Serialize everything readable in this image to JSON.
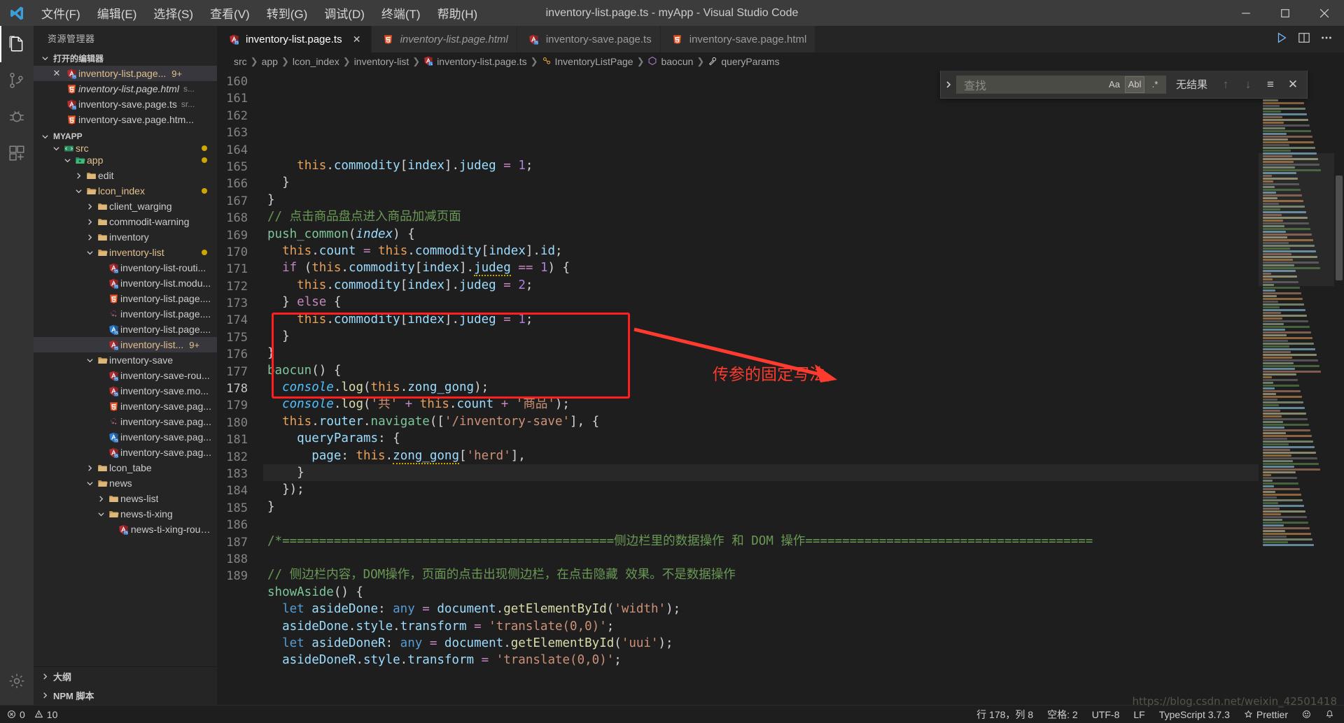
{
  "titlebar": {
    "window_title": "inventory-list.page.ts - myApp - Visual Studio Code",
    "menus": [
      "文件(F)",
      "编辑(E)",
      "选择(S)",
      "查看(V)",
      "转到(G)",
      "调试(D)",
      "终端(T)",
      "帮助(H)"
    ],
    "controls": {
      "minimize": "minimize",
      "maximize": "maximize",
      "close": "close"
    }
  },
  "activitybar": {
    "items": [
      {
        "name": "explorer",
        "icon": "files-icon"
      },
      {
        "name": "source-control",
        "icon": "source-control-icon"
      },
      {
        "name": "debug",
        "icon": "debug-icon"
      },
      {
        "name": "extensions",
        "icon": "extensions-icon"
      },
      {
        "name": "settings",
        "icon": "gear-icon"
      }
    ]
  },
  "sidebar": {
    "title": "资源管理器",
    "open_editors": {
      "label": "打开的编辑器",
      "items": [
        {
          "name": "inventory-list.page...",
          "badge": "9+",
          "icon": "angular-ts-icon",
          "selected": true,
          "italic": false,
          "modified": true
        },
        {
          "name": "inventory-list.page.html",
          "path": "s...",
          "icon": "html-icon",
          "italic": true,
          "modified": false
        },
        {
          "name": "inventory-save.page.ts",
          "path": "sr...",
          "icon": "angular-ts-icon",
          "italic": false,
          "modified": false
        },
        {
          "name": "inventory-save.page.htm...",
          "path": "",
          "icon": "html-icon",
          "italic": false,
          "modified": false
        }
      ]
    },
    "workspace": {
      "label": "MYAPP",
      "tree": [
        {
          "label": "src",
          "type": "folder-open",
          "depth": 1,
          "icon": "src-folder-icon",
          "modified": true,
          "clipped": true
        },
        {
          "label": "app",
          "type": "folder-open",
          "depth": 2,
          "icon": "app-folder-icon",
          "modified": true
        },
        {
          "label": "edit",
          "type": "folder",
          "depth": 3,
          "icon": "folder-icon"
        },
        {
          "label": "lcon_index",
          "type": "folder-open",
          "depth": 3,
          "icon": "folder-open-icon",
          "modified": true
        },
        {
          "label": "client_warging",
          "type": "folder",
          "depth": 4,
          "icon": "folder-icon"
        },
        {
          "label": "commodit-warning",
          "type": "folder",
          "depth": 4,
          "icon": "folder-icon"
        },
        {
          "label": "inventory",
          "type": "folder",
          "depth": 4,
          "icon": "folder-icon"
        },
        {
          "label": "inventory-list",
          "type": "folder-open",
          "depth": 4,
          "icon": "folder-open-icon",
          "modified": true
        },
        {
          "label": "inventory-list-routi...",
          "type": "file",
          "depth": 5,
          "icon": "angular-ts-icon"
        },
        {
          "label": "inventory-list.modu...",
          "type": "file",
          "depth": 5,
          "icon": "angular-ts-icon"
        },
        {
          "label": "inventory-list.page....",
          "type": "file",
          "depth": 5,
          "icon": "html-icon"
        },
        {
          "label": "inventory-list.page....",
          "type": "file",
          "depth": 5,
          "icon": "sass-icon"
        },
        {
          "label": "inventory-list.page....",
          "type": "file",
          "depth": 5,
          "icon": "spec-ts-icon"
        },
        {
          "label": "inventory-list...",
          "type": "file",
          "depth": 5,
          "icon": "angular-ts-icon",
          "badge": "9+",
          "selected": true,
          "modified": true
        },
        {
          "label": "inventory-save",
          "type": "folder-open",
          "depth": 4,
          "icon": "folder-open-icon"
        },
        {
          "label": "inventory-save-rou...",
          "type": "file",
          "depth": 5,
          "icon": "angular-ts-icon"
        },
        {
          "label": "inventory-save.mo...",
          "type": "file",
          "depth": 5,
          "icon": "angular-ts-icon"
        },
        {
          "label": "inventory-save.pag...",
          "type": "file",
          "depth": 5,
          "icon": "html-icon"
        },
        {
          "label": "inventory-save.pag...",
          "type": "file",
          "depth": 5,
          "icon": "sass-icon"
        },
        {
          "label": "inventory-save.pag...",
          "type": "file",
          "depth": 5,
          "icon": "spec-ts-icon"
        },
        {
          "label": "inventory-save.pag...",
          "type": "file",
          "depth": 5,
          "icon": "angular-ts-icon"
        },
        {
          "label": "lcon_tabe",
          "type": "folder",
          "depth": 4,
          "icon": "folder-icon"
        },
        {
          "label": "news",
          "type": "folder-open",
          "depth": 4,
          "icon": "folder-open-icon"
        },
        {
          "label": "news-list",
          "type": "folder",
          "depth": 5,
          "icon": "folder-icon"
        },
        {
          "label": "news-ti-xing",
          "type": "folder-open",
          "depth": 5,
          "icon": "folder-open-icon"
        },
        {
          "label": "news-ti-xing-routin...",
          "type": "file",
          "depth": 6,
          "icon": "angular-ts-icon"
        }
      ]
    },
    "bottom_sections": [
      "大纲",
      "NPM 脚本"
    ]
  },
  "tabs": [
    {
      "label": "inventory-list.page.ts",
      "icon": "angular-ts-icon",
      "active": true,
      "italic": false,
      "closeable": true
    },
    {
      "label": "inventory-list.page.html",
      "icon": "html-icon",
      "active": false,
      "italic": true,
      "closeable": false
    },
    {
      "label": "inventory-save.page.ts",
      "icon": "angular-ts-icon",
      "active": false,
      "italic": false,
      "closeable": false
    },
    {
      "label": "inventory-save.page.html",
      "icon": "html-icon",
      "active": false,
      "italic": false,
      "closeable": false
    }
  ],
  "tab_actions": [
    "run-icon",
    "split-editor-icon",
    "more-actions-icon"
  ],
  "breadcrumb": [
    {
      "label": "src",
      "icon": ""
    },
    {
      "label": "app",
      "icon": ""
    },
    {
      "label": "lcon_index",
      "icon": ""
    },
    {
      "label": "inventory-list",
      "icon": ""
    },
    {
      "label": "inventory-list.page.ts",
      "icon": "angular-ts-icon"
    },
    {
      "label": "InventoryListPage",
      "icon": "class-icon"
    },
    {
      "label": "baocun",
      "icon": "method-icon"
    },
    {
      "label": "queryParams",
      "icon": "property-icon"
    }
  ],
  "find_widget": {
    "placeholder": "查找",
    "value": "",
    "status": "无结果",
    "options": [
      {
        "name": "match-case",
        "glyph": "Aa",
        "on": false
      },
      {
        "name": "whole-word",
        "glyph": "Abl",
        "on": true
      },
      {
        "name": "regex",
        "glyph": ".*",
        "on": false
      }
    ],
    "buttons": [
      "previous-match",
      "next-match",
      "find-in-selection",
      "close"
    ]
  },
  "editor": {
    "first_line": 160,
    "current_line": 178,
    "lines": [
      {
        "n": 160,
        "html": "<span class=\"ind\">    </span><span class=\"th\">this</span>.<span class=\"pr\">commodity</span>[<span class=\"pr\">index</span>].<span class=\"pr\">judeg</span> <span class=\"pk\">=</span> <span class=\"num\">1</span>;"
      },
      {
        "n": 161,
        "html": "<span class=\"ind\">  </span>}"
      },
      {
        "n": 162,
        "html": "}"
      },
      {
        "n": 163,
        "html": "<span class=\"cm\">// 点击商品盘点进入商品加减页面</span>"
      },
      {
        "n": 164,
        "html": "<span class=\"fd\">push_common</span>(<span class=\"par\">index</span>) {"
      },
      {
        "n": 165,
        "html": "<span class=\"ind\">  </span><span class=\"th\">this</span>.<span class=\"pr\">count</span> <span class=\"pk\">=</span> <span class=\"th\">this</span>.<span class=\"pr\">commodity</span>[<span class=\"pr\">index</span>].<span class=\"pr\">id</span>;"
      },
      {
        "n": 166,
        "html": "<span class=\"ind\">  </span><span class=\"k\">if</span> (<span class=\"th\">this</span>.<span class=\"pr\">commodity</span>[<span class=\"pr\">index</span>].<span class=\"pr wavy\">judeg</span> <span class=\"pk\">==</span> <span class=\"num\">1</span>) {"
      },
      {
        "n": 167,
        "html": "<span class=\"ind\">    </span><span class=\"th\">this</span>.<span class=\"pr\">commodity</span>[<span class=\"pr\">index</span>].<span class=\"pr\">judeg</span> <span class=\"pk\">=</span> <span class=\"num\">2</span>;"
      },
      {
        "n": 168,
        "html": "<span class=\"ind\">  </span>} <span class=\"k\">else</span> {"
      },
      {
        "n": 169,
        "html": "<span class=\"ind\">    </span><span class=\"th\">this</span>.<span class=\"pr\">commodity</span>[<span class=\"pr\">index</span>].<span class=\"pr\">judeg</span> <span class=\"pk\">=</span> <span class=\"num\">1</span>;"
      },
      {
        "n": 170,
        "html": "<span class=\"ind\">  </span>}"
      },
      {
        "n": 171,
        "html": "}"
      },
      {
        "n": 172,
        "html": "<span class=\"fd\">baocun</span>() {"
      },
      {
        "n": 173,
        "html": "<span class=\"ind\">  </span><span class=\"con\">console</span>.<span class=\"fn\">log</span>(<span class=\"th\">this</span>.<span class=\"pr\">zong_gong</span>);"
      },
      {
        "n": 174,
        "html": "<span class=\"ind\">  </span><span class=\"con\">console</span>.<span class=\"fn\">log</span>(<span class=\"st\">'共'</span> <span class=\"pk\">+</span> <span class=\"th\">this</span>.<span class=\"pr\">count</span> <span class=\"pk\">+</span> <span class=\"st\">'商品'</span>);"
      },
      {
        "n": 175,
        "html": "<span class=\"ind\">  </span><span class=\"th\">this</span>.<span class=\"pr\">router</span>.<span class=\"fd\">navigate</span>([<span class=\"st\">'/inventory-save'</span>], {"
      },
      {
        "n": 176,
        "html": "<span class=\"ind\">    </span><span class=\"pr\">queryParams</span>: {"
      },
      {
        "n": 177,
        "html": "<span class=\"ind\">      </span><span class=\"pr\">page</span>: <span class=\"th\">this</span>.<span class=\"pr wavy\">zong_gong</span>[<span class=\"st\">'herd'</span>],"
      },
      {
        "n": 178,
        "html": "<span class=\"ind\">    </span>}"
      },
      {
        "n": 179,
        "html": "<span class=\"ind\">  </span>});"
      },
      {
        "n": 180,
        "html": "}"
      },
      {
        "n": 181,
        "html": ""
      },
      {
        "n": 182,
        "html": "<span class=\"cm\">/*=============================================侧边栏里的数据操作 和 DOM 操作=======================================</span>"
      },
      {
        "n": 183,
        "html": ""
      },
      {
        "n": 184,
        "html": "<span class=\"cm\">// 侧边栏内容，DOM操作，页面的点击出现侧边栏，在点击隐藏 效果。不是数据操作</span>"
      },
      {
        "n": 185,
        "html": "<span class=\"fd\">showAside</span>() {"
      },
      {
        "n": 186,
        "html": "<span class=\"ind\">  </span><span class=\"kw\">let</span> <span class=\"pr\">asideDone</span>: <span class=\"kw\">any</span> <span class=\"pk\">=</span> <span class=\"pr\">document</span>.<span class=\"fn\">getElementById</span>(<span class=\"st\">'width'</span>);"
      },
      {
        "n": 187,
        "html": "<span class=\"ind\">  </span><span class=\"pr\">asideDone</span>.<span class=\"pr\">style</span>.<span class=\"pr\">transform</span> <span class=\"pk\">=</span> <span class=\"st\">'translate(0,0)'</span>;"
      },
      {
        "n": 188,
        "html": "<span class=\"ind\">  </span><span class=\"kw\">let</span> <span class=\"pr\">asideDoneR</span>: <span class=\"kw\">any</span> <span class=\"pk\">=</span> <span class=\"pr\">document</span>.<span class=\"fn\">getElementById</span>(<span class=\"st\">'uui'</span>);"
      },
      {
        "n": 189,
        "html": "<span class=\"ind\">  </span><span class=\"pr\">asideDoneR</span>.<span class=\"pr\">style</span>.<span class=\"pr\">transform</span> <span class=\"pk\">=</span> <span class=\"st\">'translate(0,0)'</span>;"
      }
    ],
    "annotation": {
      "text": "传参的固定写法，",
      "color": "#ff3b30",
      "box_color": "#ff1f1f"
    }
  },
  "statusbar": {
    "errors": "0",
    "warnings": "10",
    "right_items": [
      {
        "name": "cursor-position",
        "label": "行 178，列 8"
      },
      {
        "name": "indentation",
        "label": "空格: 2"
      },
      {
        "name": "encoding",
        "label": "UTF-8"
      },
      {
        "name": "eol",
        "label": "LF"
      },
      {
        "name": "language-mode",
        "label": "TypeScript 3.7.3"
      },
      {
        "name": "prettier",
        "label": "Prettier"
      },
      {
        "name": "feedback",
        "label": "smiley-icon"
      },
      {
        "name": "notifications",
        "label": "bell-icon"
      }
    ]
  },
  "watermark": "https://blog.csdn.net/weixin_42501418"
}
